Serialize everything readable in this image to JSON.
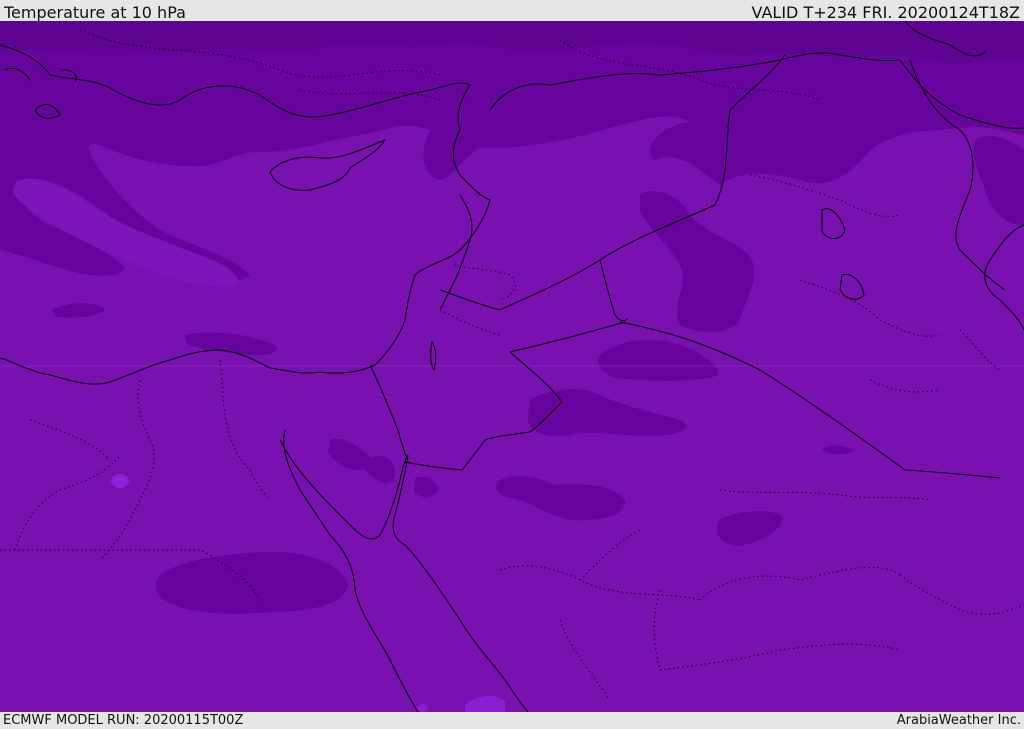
{
  "header": {
    "title": "Temperature at 10 hPa",
    "valid_time": "VALID T+234 FRI. 20200124T18Z"
  },
  "footer": {
    "model_run": "ECMWF MODEL RUN: 20200115T00Z",
    "credit": "ArabiaWeather Inc."
  },
  "map": {
    "colors": {
      "base": "#7811b0",
      "dark": "#66049d",
      "darker": "#5e0392",
      "light": "#8a1ed0",
      "coast": "#000000"
    }
  }
}
